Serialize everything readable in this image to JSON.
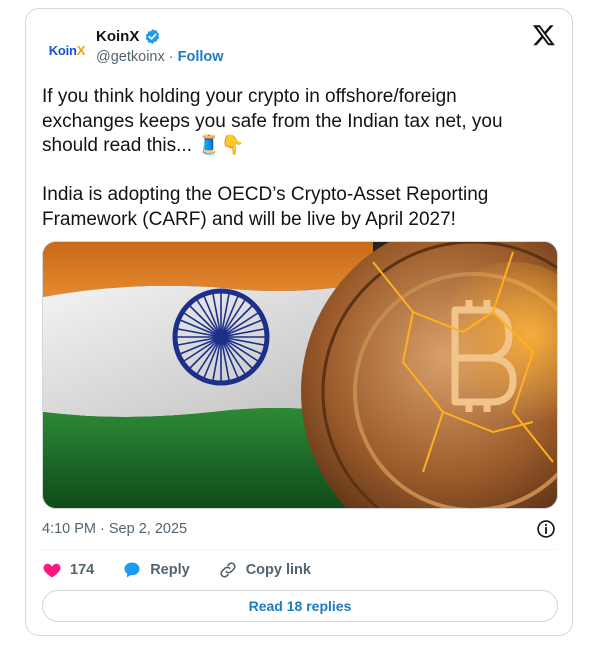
{
  "account": {
    "avatar_text_main": "Koin",
    "avatar_text_accent": "X",
    "name": "KoinX",
    "handle": "@getkoinx",
    "separator": " · ",
    "follow_label": "Follow"
  },
  "tweet": {
    "text": "If you think holding your crypto in offshore/foreign exchanges keeps you safe from the Indian tax net, you should read this... 🧵👇\n\nIndia is adopting the OECD’s Crypto-Asset Reporting Framework (CARF) and will be live by April 2027!",
    "timestamp": "4:10 PM · Sep 2, 2025"
  },
  "actions": {
    "likes": "174",
    "reply_label": "Reply",
    "copy_link_label": "Copy link"
  },
  "footer": {
    "read_replies_label": "Read 18 replies"
  },
  "colors": {
    "like": "#f91880",
    "reply": "#1d9bf0",
    "link": "#1d7bc2",
    "verified": "#1d9bf0"
  }
}
